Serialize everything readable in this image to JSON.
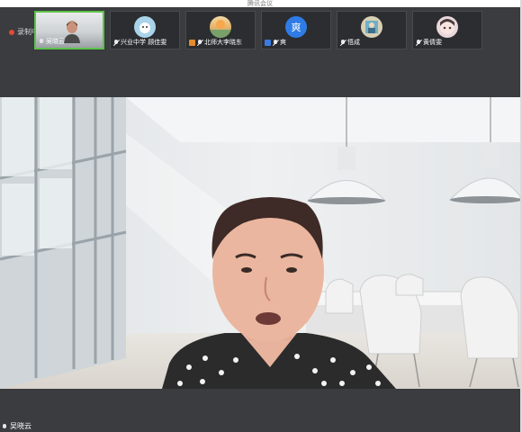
{
  "window": {
    "title": "腾讯会议"
  },
  "recording": {
    "label": "录制中"
  },
  "participants": [
    {
      "name": "吴晓云",
      "type": "video",
      "active": true,
      "muted": false
    },
    {
      "name": "兴业中学 顾佳雯",
      "type": "avatar",
      "avatar_color": "#a9d4ea",
      "muted": true
    },
    {
      "name": "北师大李晓东",
      "type": "avatar",
      "avatar_color": "#e8b36b",
      "muted": true,
      "host": true
    },
    {
      "name": "爽",
      "type": "avatar",
      "avatar_color": "#2f7be6",
      "avatar_text": "爽",
      "muted": true,
      "cohost": true
    },
    {
      "name": "悟成",
      "type": "avatar",
      "avatar_color": "#c8c2a6",
      "muted": true
    },
    {
      "name": "黄倩雯",
      "type": "avatar",
      "avatar_color": "#e9d7dc",
      "muted": true
    }
  ],
  "main_speaker": {
    "name": "吴晓云"
  }
}
